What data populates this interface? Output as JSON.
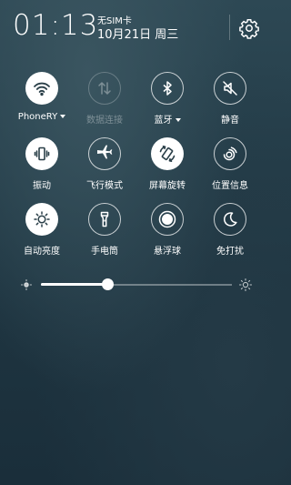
{
  "header": {
    "time": "01:13",
    "carrier": "无SIM卡",
    "date": "10月21日 周三",
    "settings_icon": "gear-icon"
  },
  "toggles": [
    {
      "label": "PhoneRY",
      "icon": "wifi-icon",
      "state": "on",
      "dropdown": true
    },
    {
      "label": "数据连接",
      "icon": "data-arrows-icon",
      "state": "disabled",
      "dropdown": false
    },
    {
      "label": "蓝牙",
      "icon": "bluetooth-icon",
      "state": "off",
      "dropdown": true
    },
    {
      "label": "静音",
      "icon": "mute-icon",
      "state": "off",
      "dropdown": false
    },
    {
      "label": "振动",
      "icon": "vibrate-icon",
      "state": "on",
      "dropdown": false
    },
    {
      "label": "飞行模式",
      "icon": "airplane-icon",
      "state": "off",
      "dropdown": false
    },
    {
      "label": "屏幕旋转",
      "icon": "rotate-icon",
      "state": "on",
      "dropdown": false
    },
    {
      "label": "位置信息",
      "icon": "location-icon",
      "state": "off",
      "dropdown": false
    },
    {
      "label": "自动亮度",
      "icon": "brightness-icon",
      "state": "on",
      "dropdown": false
    },
    {
      "label": "手电筒",
      "icon": "flashlight-icon",
      "state": "off",
      "dropdown": false
    },
    {
      "label": "悬浮球",
      "icon": "floating-ball-icon",
      "state": "off",
      "dropdown": false
    },
    {
      "label": "免打扰",
      "icon": "moon-icon",
      "state": "off",
      "dropdown": false
    }
  ],
  "brightness": {
    "level": 0.35,
    "low_icon": "brightness-low-icon",
    "high_icon": "brightness-high-icon"
  }
}
